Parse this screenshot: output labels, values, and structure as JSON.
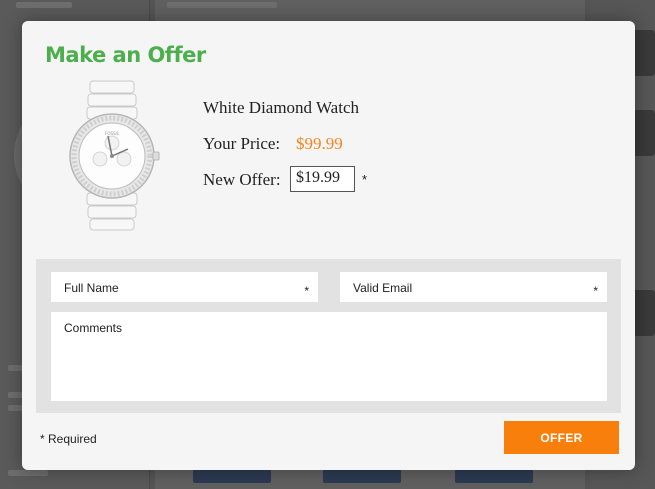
{
  "modal": {
    "title": "Make an Offer",
    "product": {
      "name": "White Diamond Watch",
      "brand_mark": "FOSSIL"
    },
    "price_label": "Your Price:",
    "price_value": "$99.99",
    "offer_label": "New Offer:",
    "offer_value": "$19.99",
    "offer_required_mark": "*",
    "form": {
      "name_placeholder": "Full Name",
      "name_required_mark": "*",
      "email_placeholder": "Valid Email",
      "email_required_mark": "*",
      "comments_placeholder": "Comments"
    },
    "required_note": "* Required",
    "offer_button_label": "OFFER"
  },
  "colors": {
    "title_green": "#4cae4c",
    "price_orange": "#f5851f",
    "button_orange": "#f97f0d",
    "overlay": "#555555"
  },
  "icons": {
    "product_image": "wristwatch-icon"
  }
}
